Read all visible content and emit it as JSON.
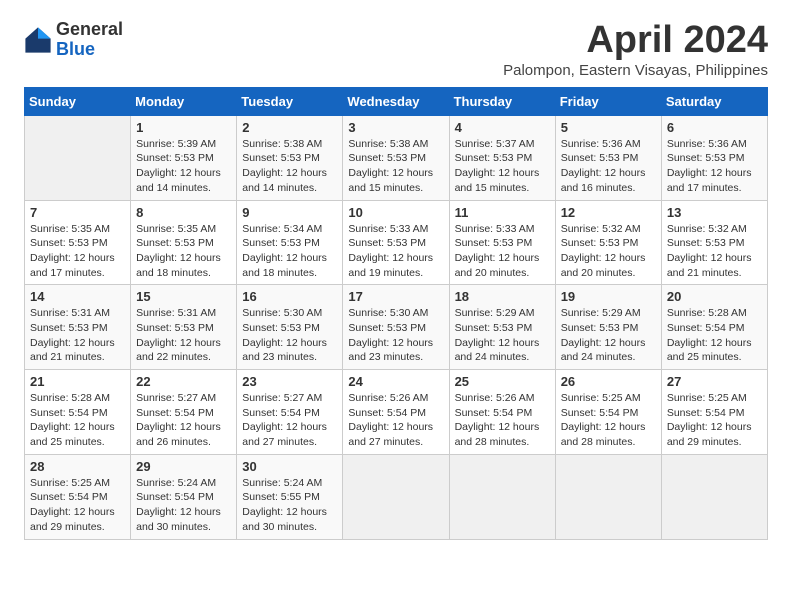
{
  "logo": {
    "general": "General",
    "blue": "Blue"
  },
  "title": "April 2024",
  "subtitle": "Palompon, Eastern Visayas, Philippines",
  "days_header": [
    "Sunday",
    "Monday",
    "Tuesday",
    "Wednesday",
    "Thursday",
    "Friday",
    "Saturday"
  ],
  "weeks": [
    [
      {
        "day": "",
        "info": ""
      },
      {
        "day": "1",
        "info": "Sunrise: 5:39 AM\nSunset: 5:53 PM\nDaylight: 12 hours\nand 14 minutes."
      },
      {
        "day": "2",
        "info": "Sunrise: 5:38 AM\nSunset: 5:53 PM\nDaylight: 12 hours\nand 14 minutes."
      },
      {
        "day": "3",
        "info": "Sunrise: 5:38 AM\nSunset: 5:53 PM\nDaylight: 12 hours\nand 15 minutes."
      },
      {
        "day": "4",
        "info": "Sunrise: 5:37 AM\nSunset: 5:53 PM\nDaylight: 12 hours\nand 15 minutes."
      },
      {
        "day": "5",
        "info": "Sunrise: 5:36 AM\nSunset: 5:53 PM\nDaylight: 12 hours\nand 16 minutes."
      },
      {
        "day": "6",
        "info": "Sunrise: 5:36 AM\nSunset: 5:53 PM\nDaylight: 12 hours\nand 17 minutes."
      }
    ],
    [
      {
        "day": "7",
        "info": "Sunrise: 5:35 AM\nSunset: 5:53 PM\nDaylight: 12 hours\nand 17 minutes."
      },
      {
        "day": "8",
        "info": "Sunrise: 5:35 AM\nSunset: 5:53 PM\nDaylight: 12 hours\nand 18 minutes."
      },
      {
        "day": "9",
        "info": "Sunrise: 5:34 AM\nSunset: 5:53 PM\nDaylight: 12 hours\nand 18 minutes."
      },
      {
        "day": "10",
        "info": "Sunrise: 5:33 AM\nSunset: 5:53 PM\nDaylight: 12 hours\nand 19 minutes."
      },
      {
        "day": "11",
        "info": "Sunrise: 5:33 AM\nSunset: 5:53 PM\nDaylight: 12 hours\nand 20 minutes."
      },
      {
        "day": "12",
        "info": "Sunrise: 5:32 AM\nSunset: 5:53 PM\nDaylight: 12 hours\nand 20 minutes."
      },
      {
        "day": "13",
        "info": "Sunrise: 5:32 AM\nSunset: 5:53 PM\nDaylight: 12 hours\nand 21 minutes."
      }
    ],
    [
      {
        "day": "14",
        "info": "Sunrise: 5:31 AM\nSunset: 5:53 PM\nDaylight: 12 hours\nand 21 minutes."
      },
      {
        "day": "15",
        "info": "Sunrise: 5:31 AM\nSunset: 5:53 PM\nDaylight: 12 hours\nand 22 minutes."
      },
      {
        "day": "16",
        "info": "Sunrise: 5:30 AM\nSunset: 5:53 PM\nDaylight: 12 hours\nand 23 minutes."
      },
      {
        "day": "17",
        "info": "Sunrise: 5:30 AM\nSunset: 5:53 PM\nDaylight: 12 hours\nand 23 minutes."
      },
      {
        "day": "18",
        "info": "Sunrise: 5:29 AM\nSunset: 5:53 PM\nDaylight: 12 hours\nand 24 minutes."
      },
      {
        "day": "19",
        "info": "Sunrise: 5:29 AM\nSunset: 5:53 PM\nDaylight: 12 hours\nand 24 minutes."
      },
      {
        "day": "20",
        "info": "Sunrise: 5:28 AM\nSunset: 5:54 PM\nDaylight: 12 hours\nand 25 minutes."
      }
    ],
    [
      {
        "day": "21",
        "info": "Sunrise: 5:28 AM\nSunset: 5:54 PM\nDaylight: 12 hours\nand 25 minutes."
      },
      {
        "day": "22",
        "info": "Sunrise: 5:27 AM\nSunset: 5:54 PM\nDaylight: 12 hours\nand 26 minutes."
      },
      {
        "day": "23",
        "info": "Sunrise: 5:27 AM\nSunset: 5:54 PM\nDaylight: 12 hours\nand 27 minutes."
      },
      {
        "day": "24",
        "info": "Sunrise: 5:26 AM\nSunset: 5:54 PM\nDaylight: 12 hours\nand 27 minutes."
      },
      {
        "day": "25",
        "info": "Sunrise: 5:26 AM\nSunset: 5:54 PM\nDaylight: 12 hours\nand 28 minutes."
      },
      {
        "day": "26",
        "info": "Sunrise: 5:25 AM\nSunset: 5:54 PM\nDaylight: 12 hours\nand 28 minutes."
      },
      {
        "day": "27",
        "info": "Sunrise: 5:25 AM\nSunset: 5:54 PM\nDaylight: 12 hours\nand 29 minutes."
      }
    ],
    [
      {
        "day": "28",
        "info": "Sunrise: 5:25 AM\nSunset: 5:54 PM\nDaylight: 12 hours\nand 29 minutes."
      },
      {
        "day": "29",
        "info": "Sunrise: 5:24 AM\nSunset: 5:54 PM\nDaylight: 12 hours\nand 30 minutes."
      },
      {
        "day": "30",
        "info": "Sunrise: 5:24 AM\nSunset: 5:55 PM\nDaylight: 12 hours\nand 30 minutes."
      },
      {
        "day": "",
        "info": ""
      },
      {
        "day": "",
        "info": ""
      },
      {
        "day": "",
        "info": ""
      },
      {
        "day": "",
        "info": ""
      }
    ]
  ]
}
